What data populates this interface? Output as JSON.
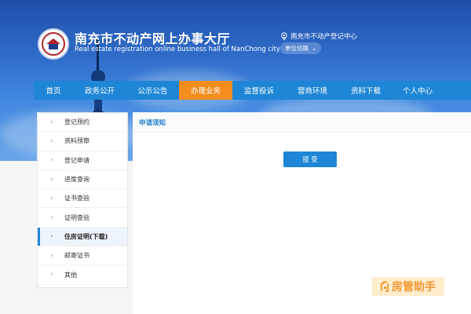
{
  "header": {
    "title": "南充市不动产网上办事大厅",
    "subtitle": "Real estate registration online business hall of NanChong city",
    "location": "南充市不动产登记中心",
    "unit_switch": "单位切换"
  },
  "nav": {
    "items": [
      {
        "label": "首页"
      },
      {
        "label": "政务公开"
      },
      {
        "label": "公示公告"
      },
      {
        "label": "办理业务"
      },
      {
        "label": "监督投诉"
      },
      {
        "label": "营商环境"
      },
      {
        "label": "资料下载"
      },
      {
        "label": "个人中心"
      }
    ],
    "active": "办理业务"
  },
  "sidebar": {
    "items": [
      {
        "label": "登记预约"
      },
      {
        "label": "资料预审"
      },
      {
        "label": "登记申请"
      },
      {
        "label": "进度查询"
      },
      {
        "label": "证书查验"
      },
      {
        "label": "证明查验"
      },
      {
        "label": "住房证明(下载)"
      },
      {
        "label": "邮寄证书"
      },
      {
        "label": "其他"
      }
    ],
    "active": "住房证明(下载)"
  },
  "content": {
    "title": "申请须知",
    "accept_button": "接 受"
  },
  "watermark": {
    "text": "房管助手"
  },
  "colors": {
    "nav_bg": "#1e86d6",
    "nav_active": "#f28d1e",
    "accent": "#1e86d6"
  }
}
